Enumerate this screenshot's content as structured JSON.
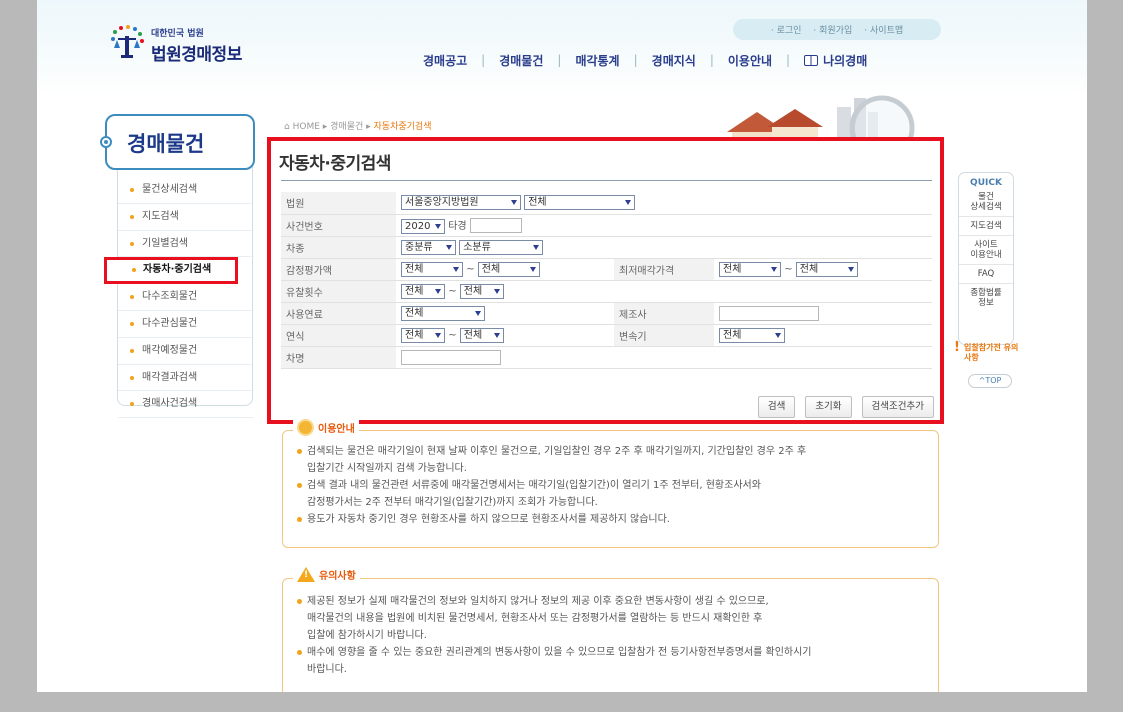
{
  "header": {
    "org_small": "대한민국 법원",
    "org_title": "법원경매정보",
    "util_links": [
      "로그인",
      "회원가입",
      "사이트맵"
    ],
    "gnb": [
      "경매공고",
      "경매물건",
      "매각통계",
      "경매지식",
      "이용안내",
      "나의경매"
    ]
  },
  "lnb": {
    "title": "경매물건",
    "items": [
      {
        "label": "물건상세검색"
      },
      {
        "label": "지도검색"
      },
      {
        "label": "기일별검색"
      },
      {
        "label": "자동차·중기검색",
        "active": true
      },
      {
        "label": "다수조회물건"
      },
      {
        "label": "다수관심물건"
      },
      {
        "label": "매각예정물건"
      },
      {
        "label": "매각결과검색"
      },
      {
        "label": "경매사건검색"
      }
    ]
  },
  "breadcrumb": {
    "home": "HOME",
    "level1": "경매물건",
    "current": "자동차중기검색"
  },
  "form": {
    "title": "자동차·중기검색",
    "court_label": "법원",
    "court_value": "서울중앙지방법원",
    "court_sub_value": "전체",
    "case_label": "사건번호",
    "case_year": "2020",
    "case_type": "타경",
    "kind_label": "차종",
    "kind_major": "중분류",
    "kind_minor": "소분류",
    "appraisal_label": "감정평가액",
    "appraisal_from": "전체",
    "appraisal_to": "전체",
    "min_price_label": "최저매각가격",
    "min_price_from": "전체",
    "min_price_to": "전체",
    "fail_label": "유찰횟수",
    "fail_from": "전체",
    "fail_to": "전체",
    "fuel_label": "사용연료",
    "fuel_value": "전체",
    "maker_label": "제조사",
    "year_label": "연식",
    "year_from": "전체",
    "year_to": "전체",
    "trans_label": "변속기",
    "trans_value": "전체",
    "name_label": "차명",
    "range_sep": "~",
    "btn_search": "검색",
    "btn_reset": "초기화",
    "btn_more": "검색조건추가"
  },
  "quick": {
    "head": "QUICK",
    "items": [
      "물건\n상세검색",
      "지도검색",
      "사이트\n이용안내",
      "FAQ",
      "종합법률\n정보"
    ],
    "notice": "입찰참가전 유의사항",
    "top": "^TOP"
  },
  "guide": {
    "tag": "이용안내",
    "lines": [
      {
        "text": "검색되는 물건은 매각기일이 현재 날짜 이후인 물건으로, 기일입찰인 경우 2주 후 매각기일까지, 기간입찰인 경우 2주 후",
        "bullet": true
      },
      {
        "text": "입찰기간 시작일까지 검색 가능합니다.",
        "bullet": false
      },
      {
        "text": "검색 결과 내의 물건관련 서류중에 매각물건명세서는 매각기일(입찰기간)이 열리기 1주 전부터, 현황조사서와",
        "bullet": true
      },
      {
        "text": "감정평가서는 2주 전부터 매각기일(입찰기간)까지 조회가 가능합니다.",
        "bullet": false
      },
      {
        "text": "용도가 자동차 중기인 경우 현황조사를 하지 않으므로 현황조사서를 제공하지 않습니다.",
        "bullet": true
      }
    ]
  },
  "caution": {
    "tag": "유의사항",
    "lines": [
      {
        "text": "제공된 정보가 실제 매각물건의 정보와 일치하지 않거나 정보의 제공 이후 중요한 변동사항이 생길 수 있으므로,",
        "bullet": true
      },
      {
        "text": "매각물건의 내용을 법원에 비치된 물건명세서, 현황조사서 또는 감정평가서를 열람하는 등 반드시 재확인한 후",
        "bullet": false
      },
      {
        "text": "입찰에 참가하시기 바랍니다.",
        "bullet": false
      },
      {
        "text": "매수에 영향을 줄 수 있는 중요한 권리관계의 변동사항이 있을 수 있으므로 입찰참가 전 등기사항전부증명서를 확인하시기",
        "bullet": true
      },
      {
        "text": "바랍니다.",
        "bullet": false
      }
    ]
  },
  "colors": {
    "brand": "#1b2b78",
    "highlight": "#e8101f",
    "accent": "#f2a21c"
  }
}
